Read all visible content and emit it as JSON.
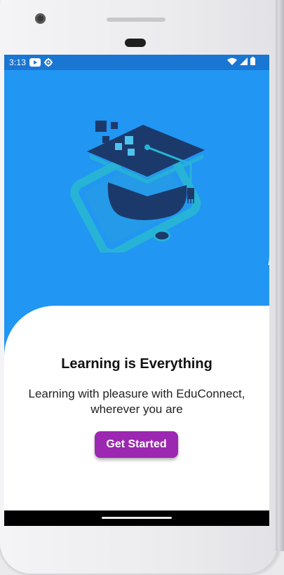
{
  "status_bar": {
    "time": "3:13",
    "icons_left": [
      "youtube-icon",
      "settings-icon"
    ],
    "icons_right": [
      "wifi-icon",
      "signal-icon",
      "battery-icon"
    ]
  },
  "hero": {
    "logo_icon": "graduation-cap-phone-icon",
    "colors": {
      "background": "#2196f3",
      "logo_dark": "#1b3a6b",
      "logo_light": "#27b3d6"
    }
  },
  "content": {
    "title": "Learning is Everything",
    "subtitle_line1": "Learning with pleasure with EduConnect,",
    "subtitle_line2": "wherever you are"
  },
  "cta": {
    "label": "Get Started",
    "color": "#9c27b0"
  }
}
